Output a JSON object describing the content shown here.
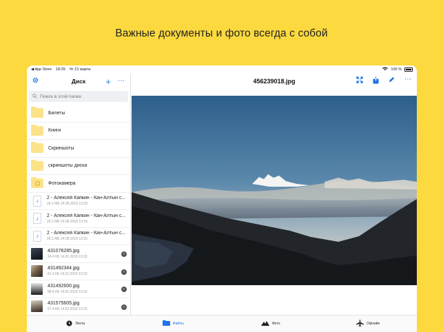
{
  "headline": "Важные документы и фото всегда с собой",
  "status": {
    "back_app": "◀ App Store",
    "time": "18:29",
    "date": "Чт 21 марта",
    "battery": "100 %"
  },
  "sidebar": {
    "title": "Диск",
    "search_placeholder": "Поиск в этой папке",
    "folders": [
      {
        "name": "Билеты"
      },
      {
        "name": "Книги"
      },
      {
        "name": "Скриншоты"
      },
      {
        "name": "скриншоты диска"
      },
      {
        "name": "Фотокамера"
      }
    ],
    "audio": [
      {
        "name": "2 - Алексей Капкин - Кан-Алтын с...",
        "meta": "26.1 МБ  24.08.2018 13:33"
      },
      {
        "name": "2 - Алексей Капкин - Кан-Алтын с...",
        "meta": "26.1 МБ  24.08.2018 13:33"
      },
      {
        "name": "2 - Алексей Капкин - Кан-Алтын с...",
        "meta": "26.1 МБ  24.08.2018 13:33"
      }
    ],
    "images": [
      {
        "name": "431076285.jpg",
        "meta": "24.6 КБ  14.02.2018 13:33"
      },
      {
        "name": "431492344.jpg",
        "meta": "81.6 КБ  14.02.2018 13:33"
      },
      {
        "name": "431492600.jpg",
        "meta": "98.6 КБ  14.02.2018 13:33"
      },
      {
        "name": "431575605.jpg",
        "meta": "67.4 КБ  14.02.2018 13:33"
      }
    ]
  },
  "main": {
    "title": "456239018.jpg"
  },
  "tabs": [
    {
      "label": "Лента",
      "icon": "clock-icon"
    },
    {
      "label": "Файлы",
      "icon": "folder-icon"
    },
    {
      "label": "Фото",
      "icon": "mountain-icon"
    },
    {
      "label": "Офлайн",
      "icon": "airplane-icon"
    }
  ],
  "colors": {
    "background": "#FCD93E",
    "accent": "#1e73e8"
  }
}
